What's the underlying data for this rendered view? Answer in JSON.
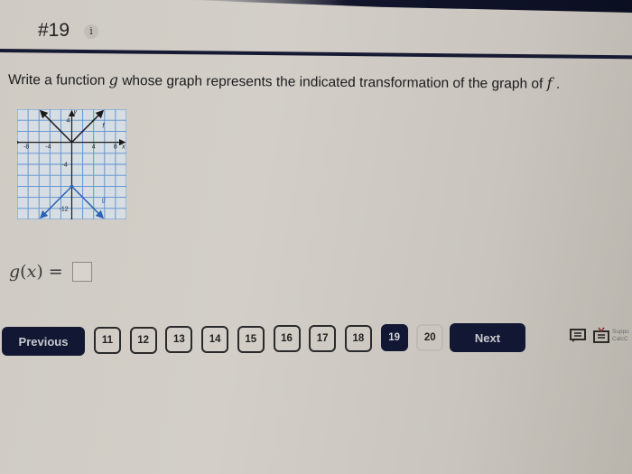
{
  "header": {
    "question_number": "#19",
    "info_icon": "i"
  },
  "prompt": {
    "before_g": "Write a function ",
    "g": "g",
    "middle": " whose graph represents the indicated transformation of the graph of ",
    "f": "f",
    "end": " ."
  },
  "graph": {
    "x_range": [
      -10,
      10
    ],
    "y_range": [
      -14,
      6
    ],
    "grid_step": 2,
    "axis_labels": {
      "x": "x",
      "y": "y"
    },
    "x_tick_labels": [
      "-8",
      "-4",
      "4",
      "8"
    ],
    "y_tick_labels": [
      "4",
      "-4",
      "-12"
    ],
    "functions": [
      {
        "name": "f",
        "label": "f",
        "vertex": [
          0,
          0
        ],
        "opens": "up",
        "color": "#1a1a1a"
      },
      {
        "name": "g",
        "label": "g",
        "vertex": [
          0,
          -8
        ],
        "opens": "down",
        "color": "#2b63b3"
      }
    ]
  },
  "answer": {
    "label_fn": "g",
    "label_var": "x",
    "label_eq": "=",
    "value": ""
  },
  "navigation": {
    "previous_label": "Previous",
    "next_label": "Next",
    "pages": [
      {
        "label": "11",
        "state": "visited"
      },
      {
        "label": "12",
        "state": "visited"
      },
      {
        "label": "13",
        "state": "visited"
      },
      {
        "label": "14",
        "state": "visited"
      },
      {
        "label": "15",
        "state": "visited"
      },
      {
        "label": "16",
        "state": "visited"
      },
      {
        "label": "17",
        "state": "visited"
      },
      {
        "label": "18",
        "state": "visited"
      },
      {
        "label": "19",
        "state": "current"
      },
      {
        "label": "20",
        "state": "unvisited"
      }
    ]
  },
  "tools": {
    "icons": [
      "chat-icon",
      "video-help-icon"
    ],
    "support_line1": "Suppo",
    "support_line2": "CalcC"
  },
  "colors": {
    "accent_dark": "#121733",
    "graph_grid": "#5b8fd0",
    "g_curve": "#2b63b3"
  }
}
